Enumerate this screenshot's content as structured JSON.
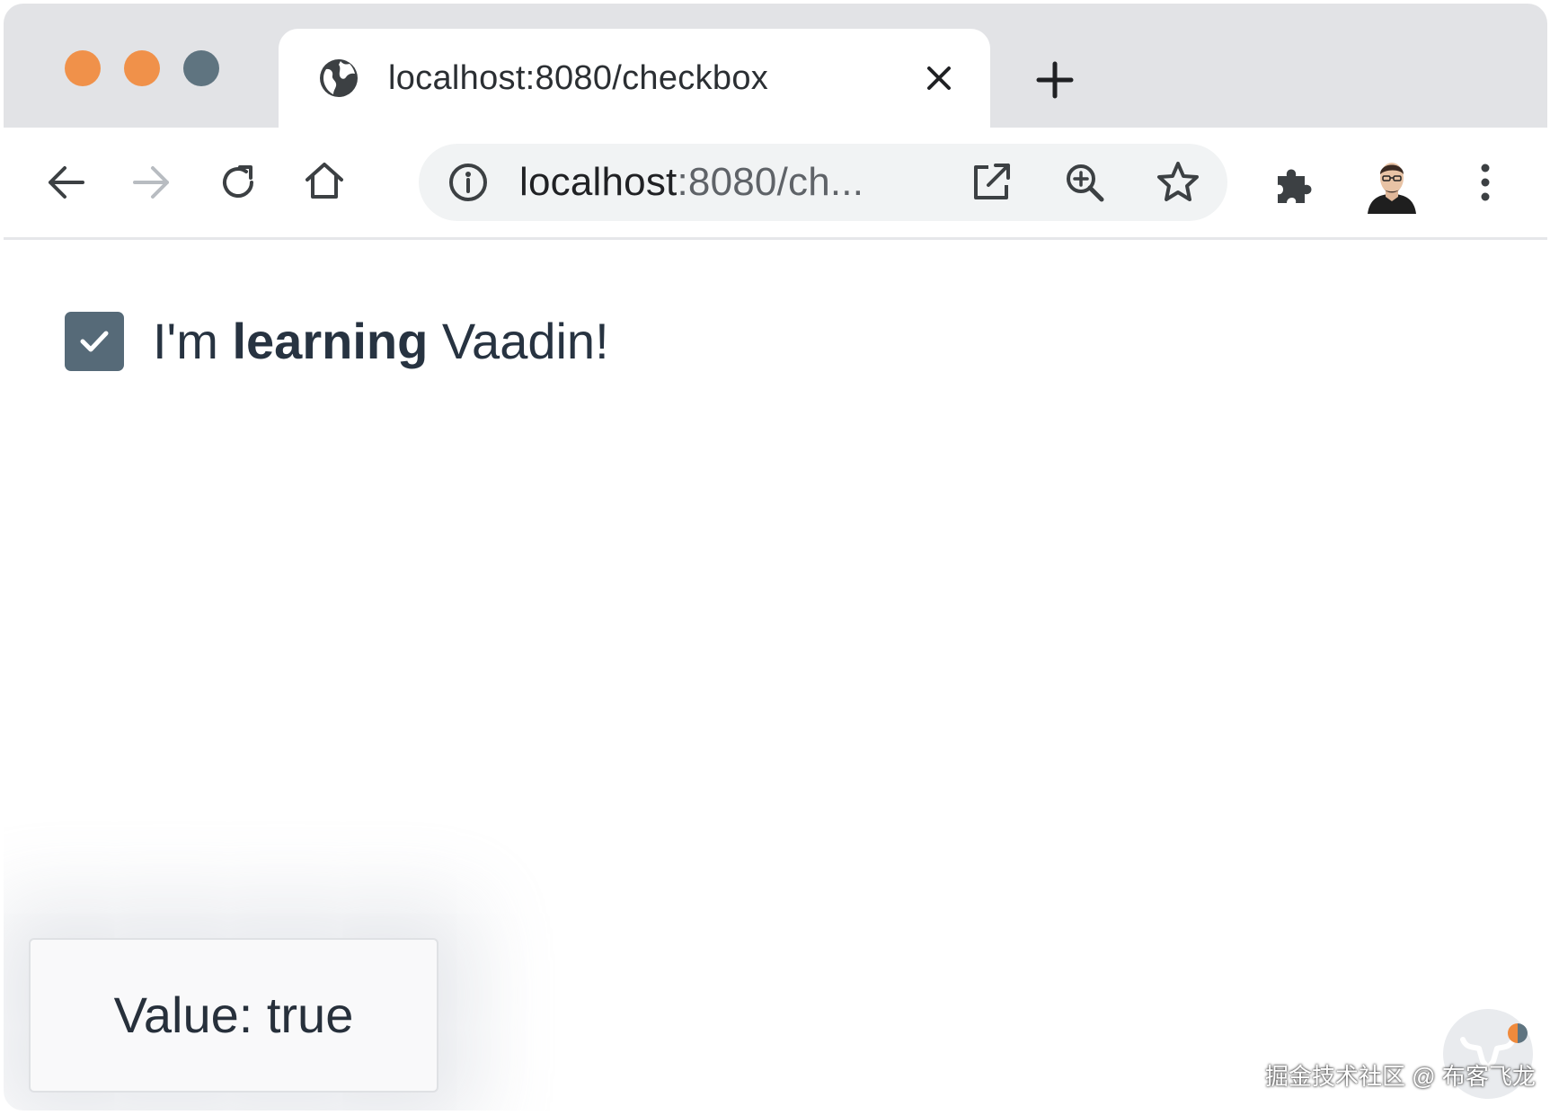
{
  "browser": {
    "tab": {
      "title": "localhost:8080/checkbox",
      "favicon": "globe-icon"
    },
    "address_bar": {
      "host": "localhost",
      "rest": ":8080/ch..."
    },
    "window_controls": [
      "close",
      "minimize",
      "zoom"
    ],
    "colors": {
      "traffic_light_orange": "#f0914a",
      "traffic_light_slate": "#5f7480",
      "titlebar": "#e2e3e6"
    }
  },
  "page": {
    "checkbox": {
      "checked": true,
      "label_prefix": "I'm ",
      "label_bold": "learning",
      "label_suffix": " Vaadin!",
      "color": "#566a78"
    },
    "notification": {
      "text": "Value: true"
    }
  },
  "watermark": {
    "text": "掘金技术社区 @ 布客飞龙"
  }
}
